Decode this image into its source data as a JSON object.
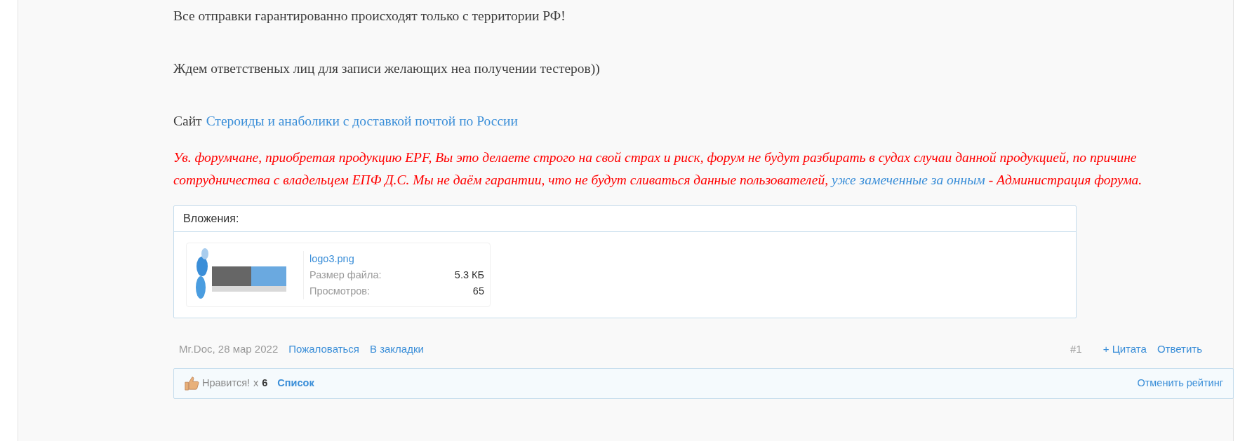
{
  "post": {
    "paragraphs": [
      "Все отправки гарантированно происходят только с территории РФ!",
      "Ждем ответственых лиц для записи желающих неа получении тестеров))"
    ],
    "site": {
      "label": "Сайт",
      "link": "Стероиды и анаболики с доставкой почтой по России"
    },
    "warning": {
      "text": "Ув. форумчане, приобретая продукцию EPF, Вы это делаете строго на свой страх и риск, форум не будут разбирать в судах случаи данной продукцией, по причине сотрудничества с владельцем ЕПФ Д.С. Мы не даём гарантии, что не будут сливаться данные пользователей,",
      "link": "уже замеченные за онным",
      "tail": "- Администрация форума."
    },
    "attachments": {
      "title": "Вложения:",
      "files": [
        {
          "kind": "picture",
          "name": "logo3.png",
          "size_label": "Размер файла:",
          "size": "5.3 КБ",
          "views_label": "Просмотров:",
          "views": "65"
        }
      ]
    },
    "footer": {
      "author_date": "Mr.Doc, 28 мар 2022",
      "links": [
        "Пожаловаться",
        "В закладки"
      ],
      "number": "#1",
      "actions": [
        "+ Цитата",
        "Ответить"
      ]
    },
    "likes": {
      "label": "Нравится!",
      "times": "x",
      "count": "6",
      "list": "Список",
      "undo": "Отменить рейтинг"
    }
  }
}
